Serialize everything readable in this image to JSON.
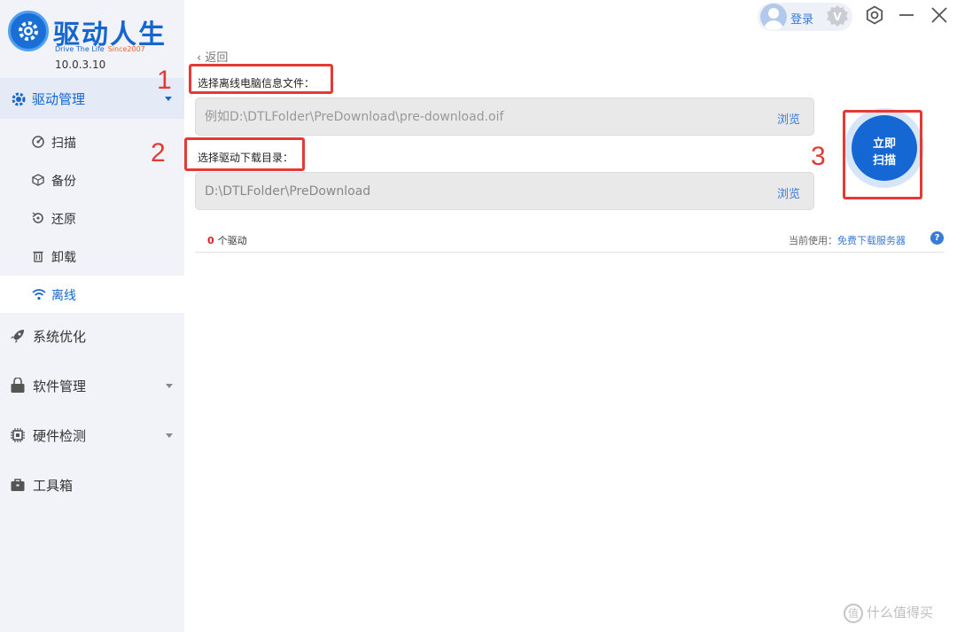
{
  "app": {
    "title": "驱动人生",
    "subtitle": "Drive The Life",
    "since": "Since2007",
    "version": "10.0.3.10"
  },
  "sidebar": {
    "driver_section": {
      "label": "驱动管理",
      "icon": "gear-icon",
      "expanded": true
    },
    "sub_items": [
      {
        "label": "扫描",
        "icon": "scan-icon"
      },
      {
        "label": "备份",
        "icon": "backup-icon"
      },
      {
        "label": "还原",
        "icon": "restore-icon"
      },
      {
        "label": "卸载",
        "icon": "trash-icon"
      },
      {
        "label": "离线",
        "icon": "wifi-icon",
        "active": true
      }
    ],
    "items": [
      {
        "label": "系统优化",
        "icon": "rocket-icon"
      },
      {
        "label": "软件管理",
        "icon": "store-icon",
        "has_caret": true
      },
      {
        "label": "硬件检测",
        "icon": "chip-icon",
        "has_caret": true
      },
      {
        "label": "工具箱",
        "icon": "toolbox-icon"
      }
    ]
  },
  "topbar": {
    "login_label": "登录",
    "vip_badge": "V"
  },
  "main": {
    "back_label": "返回",
    "offline_file": {
      "label": "选择离线电脑信息文件：",
      "placeholder": "例如D:\\DTLFolder\\PreDownload\\pre-download.oif",
      "value": "",
      "browse_label": "浏览"
    },
    "download_dir": {
      "label": "选择驱动下载目录：",
      "placeholder": "",
      "value": "D:\\DTLFolder\\PreDownload",
      "browse_label": "浏览"
    },
    "scan_button": {
      "line1": "立即",
      "line2": "扫描"
    },
    "driver_count": "0",
    "driver_count_unit": "个驱动",
    "server_prefix": "当前使用：",
    "server_link": "免费下载服务器",
    "help_label": "?"
  },
  "annotations": {
    "step1": "1",
    "step2": "2",
    "step3": "3"
  },
  "watermark": {
    "mark": "值",
    "text": "什么值得买"
  },
  "colors": {
    "brand": "#1566cf",
    "accent_red": "#e53935",
    "scan_blue": "#1567d4"
  }
}
